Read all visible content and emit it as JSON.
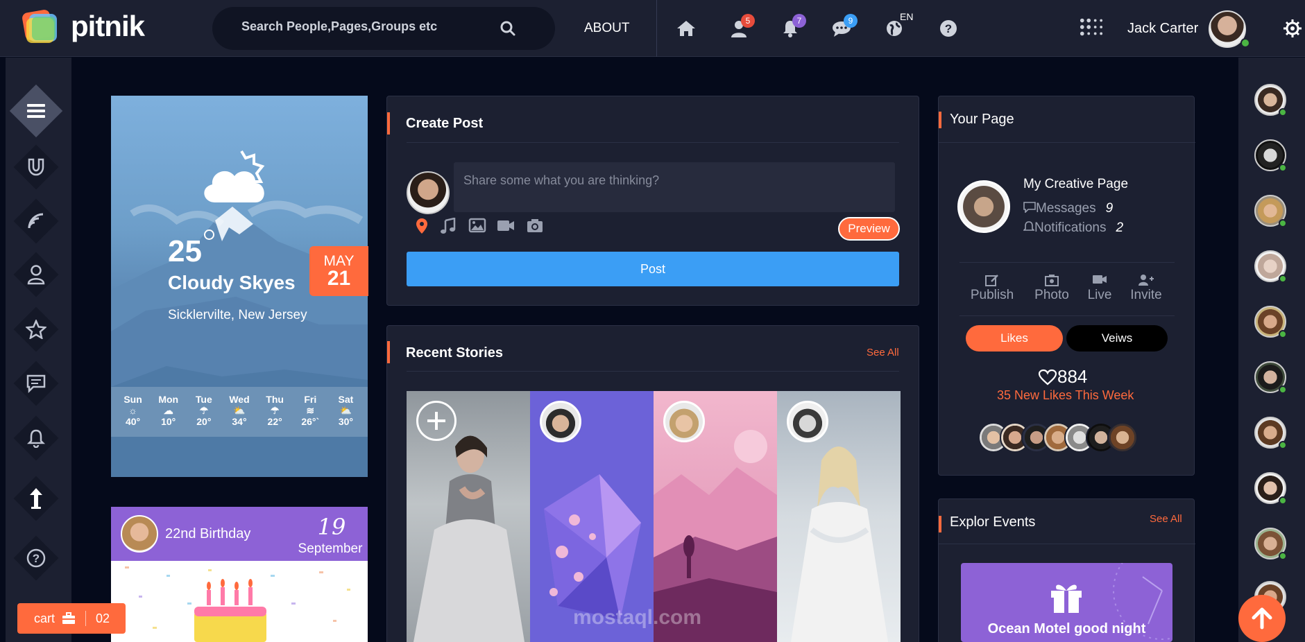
{
  "header": {
    "logo_text": "pitnik",
    "search_placeholder": "Search People,Pages,Groups etc",
    "about_label": "ABOUT",
    "badges": {
      "friends": "5",
      "notifications": "7",
      "messages": "9"
    },
    "language": "EN",
    "user_name": "Jack Carter"
  },
  "weather": {
    "temperature": "25",
    "condition": "Cloudy Skyes",
    "location": "Sicklervilte, New Jersey",
    "date_month": "MAY",
    "date_day": "21",
    "forecast": [
      {
        "day": "Sun",
        "icon": "sun-icon",
        "temp": "40°"
      },
      {
        "day": "Mon",
        "icon": "cloud-icon",
        "temp": "10°"
      },
      {
        "day": "Tue",
        "icon": "rain-icon",
        "temp": "20°"
      },
      {
        "day": "Wed",
        "icon": "sun-cloud-icon",
        "temp": "34°"
      },
      {
        "day": "Thu",
        "icon": "rain-icon",
        "temp": "22°"
      },
      {
        "day": "Fri",
        "icon": "wind-icon",
        "temp": "26°`"
      },
      {
        "day": "Sat",
        "icon": "sun-cloud-icon",
        "temp": "30°"
      }
    ]
  },
  "birthday": {
    "title": "22nd Birthday",
    "day": "19",
    "month": "September"
  },
  "create_post": {
    "title": "Create Post",
    "placeholder": "Share some what you are thinking?",
    "preview_label": "Preview",
    "post_label": "Post"
  },
  "stories": {
    "title": "Recent Stories",
    "see_all": "See All"
  },
  "your_page": {
    "title": "Your Page",
    "page_name": "My Creative Page",
    "messages_label": "Messages",
    "messages_count": "9",
    "notifications_label": "Notifications",
    "notifications_count": "2",
    "actions": [
      "Publish",
      "Photo",
      "Live",
      "Invite"
    ],
    "likes_label": "Likes",
    "views_label": "Veiws",
    "likes_count": "884",
    "likes_week": "35 New Likes This Week"
  },
  "events": {
    "title": "Explor Events",
    "see_all": "See All",
    "card_title": "Ocean Motel good night"
  },
  "cart": {
    "label": "cart",
    "count": "02"
  },
  "watermark": "mostaql.com",
  "colors": {
    "accent": "#ff6a3d",
    "primary": "#3b9ef5",
    "purple": "#8d62d6",
    "panel": "#1c2031",
    "background": "#050a1b",
    "online": "#4bb543"
  }
}
